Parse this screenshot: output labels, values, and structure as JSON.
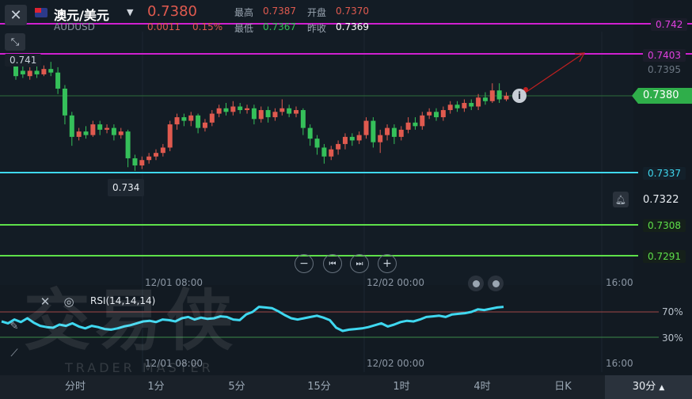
{
  "header": {
    "symbol": "澳元/美元",
    "code": "AUDUSD",
    "price": "0.7380",
    "change": "0.0011",
    "change_pct": "0.15%",
    "high_label": "最高",
    "high": "0.7387",
    "open_label": "开盘",
    "open": "0.7370",
    "low_label": "最低",
    "low": "0.7367",
    "prev_label": "昨收",
    "prev": "0.7369"
  },
  "lines": {
    "l742": "0.742",
    "l7403": "0.7403",
    "r7395": "0.7395",
    "current": "0.7380",
    "l7337": "0.7337",
    "r7322": "0.7322",
    "l7308": "0.7308",
    "l7291": "0.7291"
  },
  "annotations": {
    "max": "0.741",
    "min": "0.734"
  },
  "time_axis": {
    "t1": "12/01 08:00",
    "t2": "12/02 00:00",
    "t3": "16:00"
  },
  "indicator": {
    "name": "RSI(14,14,14)",
    "level_high": "70%",
    "level_low": "30%"
  },
  "watermark": {
    "text": "交易侠",
    "sub": "TRADER MASTER"
  },
  "tabs": [
    "分时",
    "1分",
    "5分",
    "15分",
    "1时",
    "4时",
    "日K",
    "30分"
  ],
  "active_tab": "30分",
  "colors": {
    "up": "#e05a4f",
    "down": "#35c05a",
    "magenta": "#d020d0",
    "cyan": "#3fd8f0",
    "green": "#5ee04a",
    "rsi": "#3fd8f0"
  },
  "icons": [
    "close-icon",
    "flag-icon",
    "dropdown-icon",
    "shrink-icon",
    "info-icon",
    "bell-icon",
    "zoom-out-icon",
    "prev-icon",
    "next-icon",
    "zoom-in-icon",
    "eye-icon",
    "settings-icon",
    "draw-icon"
  ]
}
